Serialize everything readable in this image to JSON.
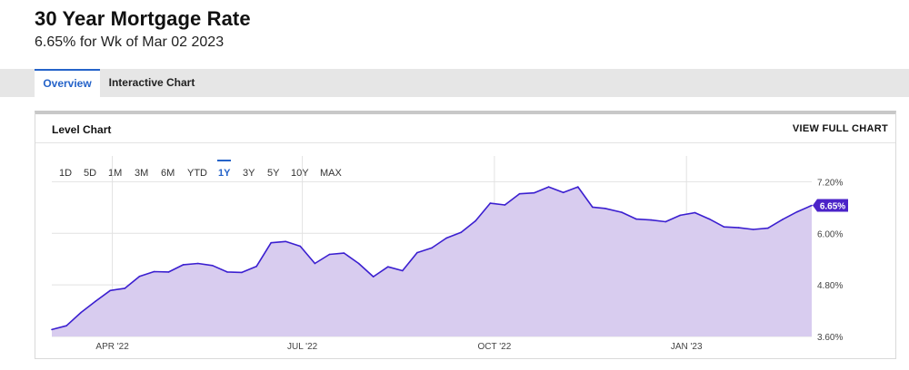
{
  "header": {
    "title": "30 Year Mortgage Rate",
    "subtitle": "6.65% for Wk of Mar 02 2023"
  },
  "tabs": [
    {
      "label": "Overview",
      "active": true
    },
    {
      "label": "Interactive Chart",
      "active": false
    }
  ],
  "panel": {
    "title": "Level Chart",
    "view_full_label": "VIEW FULL CHART"
  },
  "range_buttons": [
    {
      "label": "1D",
      "active": false
    },
    {
      "label": "5D",
      "active": false
    },
    {
      "label": "1M",
      "active": false
    },
    {
      "label": "3M",
      "active": false
    },
    {
      "label": "6M",
      "active": false
    },
    {
      "label": "YTD",
      "active": false
    },
    {
      "label": "1Y",
      "active": true
    },
    {
      "label": "3Y",
      "active": false
    },
    {
      "label": "5Y",
      "active": false
    },
    {
      "label": "10Y",
      "active": false
    },
    {
      "label": "MAX",
      "active": false
    }
  ],
  "colors": {
    "accent": "#2563c9",
    "line": "#3b1fd0",
    "fill": "#d8ccef",
    "badge": "#4b23c8",
    "grid": "#e2e2e2"
  },
  "chart_data": {
    "type": "area",
    "title": "",
    "xlabel": "",
    "ylabel": "",
    "ylim": [
      3.6,
      7.8
    ],
    "yticks": [
      "3.60%",
      "4.80%",
      "6.00%",
      "7.20%"
    ],
    "ytick_values": [
      3.6,
      4.8,
      6.0,
      7.2
    ],
    "xticks": [
      "APR '22",
      "JUL '22",
      "OCT '22",
      "JAN '23"
    ],
    "xtick_dates": [
      "2022-04-01",
      "2022-07-01",
      "2022-10-01",
      "2023-01-01"
    ],
    "grid": true,
    "last_value_label": "6.65%",
    "series": [
      {
        "x": [
          "2022-03-03",
          "2022-03-10",
          "2022-03-17",
          "2022-03-24",
          "2022-03-31",
          "2022-04-07",
          "2022-04-14",
          "2022-04-21",
          "2022-04-28",
          "2022-05-05",
          "2022-05-12",
          "2022-05-19",
          "2022-05-26",
          "2022-06-02",
          "2022-06-09",
          "2022-06-16",
          "2022-06-23",
          "2022-06-30",
          "2022-07-07",
          "2022-07-14",
          "2022-07-21",
          "2022-07-28",
          "2022-08-04",
          "2022-08-11",
          "2022-08-18",
          "2022-08-25",
          "2022-09-01",
          "2022-09-08",
          "2022-09-15",
          "2022-09-22",
          "2022-09-29",
          "2022-10-06",
          "2022-10-13",
          "2022-10-20",
          "2022-10-27",
          "2022-11-03",
          "2022-11-10",
          "2022-11-17",
          "2022-11-23",
          "2022-12-01",
          "2022-12-08",
          "2022-12-15",
          "2022-12-22",
          "2022-12-29",
          "2023-01-05",
          "2023-01-12",
          "2023-01-19",
          "2023-01-26",
          "2023-02-02",
          "2023-02-09",
          "2023-02-16",
          "2023-02-23",
          "2023-03-02"
        ],
        "values": [
          3.76,
          3.85,
          4.16,
          4.42,
          4.67,
          4.72,
          5.0,
          5.11,
          5.1,
          5.27,
          5.3,
          5.25,
          5.1,
          5.09,
          5.23,
          5.78,
          5.81,
          5.7,
          5.3,
          5.51,
          5.54,
          5.3,
          4.99,
          5.22,
          5.13,
          5.55,
          5.66,
          5.89,
          6.02,
          6.29,
          6.7,
          6.66,
          6.92,
          6.94,
          7.08,
          6.95,
          7.08,
          6.61,
          6.58,
          6.49,
          6.33,
          6.31,
          6.27,
          6.42,
          6.48,
          6.33,
          6.15,
          6.13,
          6.09,
          6.12,
          6.32,
          6.5,
          6.65
        ]
      }
    ]
  }
}
